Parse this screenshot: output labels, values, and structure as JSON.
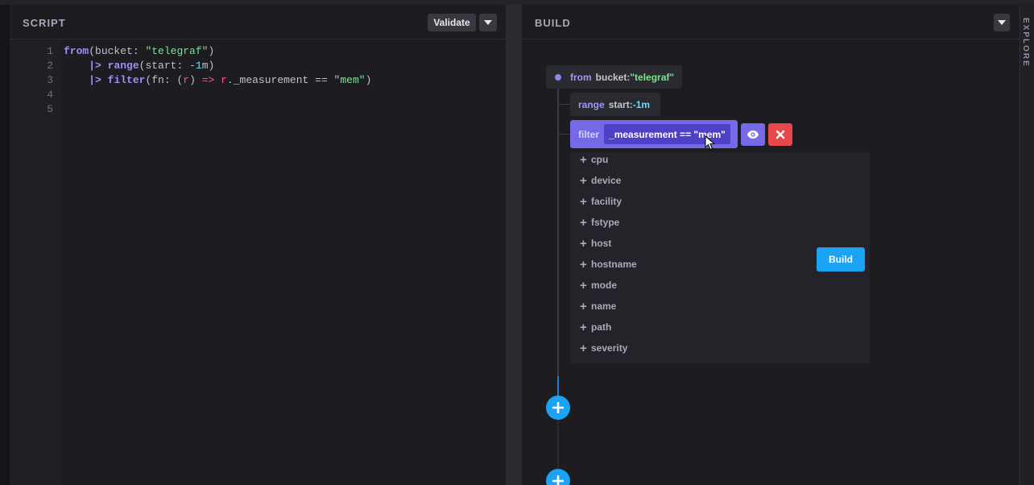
{
  "script": {
    "title": "SCRIPT",
    "validate_label": "Validate",
    "line_numbers": [
      "1",
      "2",
      "3",
      "4",
      "5"
    ],
    "code": {
      "line1": {
        "fn": "from",
        "p1": "(bucket: ",
        "s1": "\"telegraf\"",
        "p2": ")"
      },
      "line2": {
        "pipe": "|>",
        "fn": "range",
        "p1": "(start: ",
        "n1": "-1",
        "p2": "m)"
      },
      "line3": {
        "pipe": "|>",
        "fn": "filter",
        "p1": "(fn: (",
        "r1": "r",
        "p2": ") ",
        "arrow": "=>",
        "r2": "r",
        "p3": "._measurement == ",
        "s1": "\"mem\"",
        "p4": ")"
      }
    }
  },
  "build": {
    "title": "BUILD",
    "from_block": {
      "fn": "from",
      "key": "bucket:",
      "value": "\"telegraf\""
    },
    "range_block": {
      "fn": "range",
      "key": "start:",
      "value": "-1m"
    },
    "filter_block": {
      "fn": "filter",
      "value": "_measurement == \"mem\""
    },
    "suggestions": [
      "cpu",
      "device",
      "facility",
      "fstype",
      "host",
      "hostname",
      "mode",
      "name",
      "path",
      "severity"
    ],
    "build_button_label": "Build"
  },
  "explore_label": "EXPLORE",
  "icons": {
    "dropdown": "caret-down-icon",
    "eye": "eye-icon",
    "delete": "close-icon",
    "add": "plus-icon",
    "suggestion": "plus-icon"
  },
  "colors": {
    "accent_purple": "#7569e8",
    "accent_blue": "#1ba4f5",
    "danger": "#e8484c",
    "string_green": "#7ce490",
    "number_cyan": "#5ee4ff"
  }
}
